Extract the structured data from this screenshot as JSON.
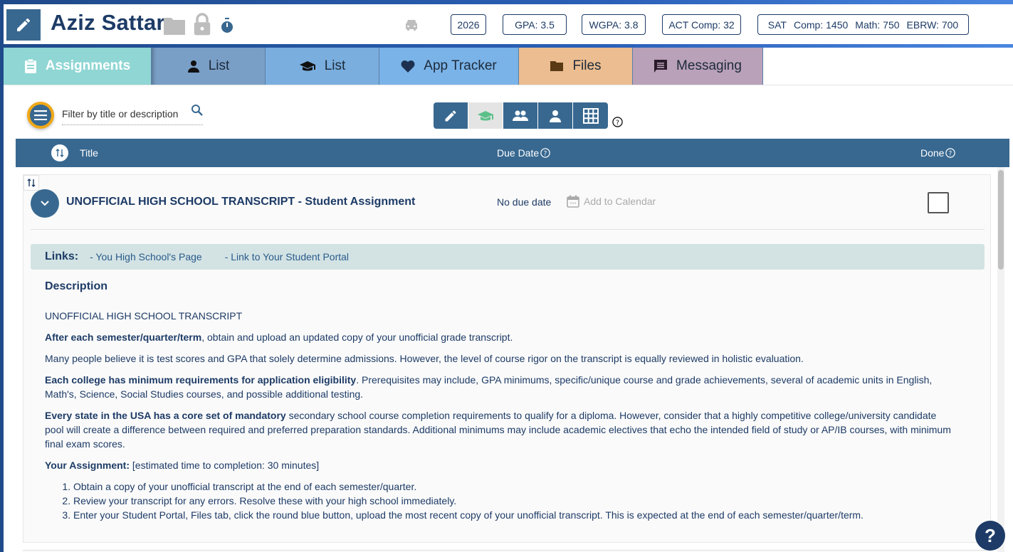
{
  "header": {
    "student_name": "Aziz Sattar",
    "icons": [
      "edit-icon",
      "folder-icon",
      "lock-icon",
      "stopwatch-icon",
      "car-icon"
    ],
    "badges": {
      "year": "2026",
      "gpa": "GPA: 3.5",
      "wgpa": "WGPA: 3.8",
      "act": "ACT Comp: 32",
      "sat_label": "SAT",
      "sat_comp": "Comp: 1450",
      "sat_math": "Math: 750",
      "sat_ebrw": "EBRW: 700"
    }
  },
  "tabs": [
    {
      "label": "Assignments",
      "icon": "clipboard-icon",
      "color": "#8fd6d4",
      "active": true
    },
    {
      "label": "List",
      "icon": "person-icon",
      "color": "#7a9fc7"
    },
    {
      "label": "List",
      "icon": "graduation-cap-icon",
      "color": "#7aaedf"
    },
    {
      "label": "App Tracker",
      "icon": "heart-icon",
      "color": "#7ab3e8"
    },
    {
      "label": "Files",
      "icon": "folder-icon",
      "color": "#ebbd90"
    },
    {
      "label": "Messaging",
      "icon": "message-icon",
      "color": "#b9a1b9"
    }
  ],
  "toolbar": {
    "filter_placeholder": "Filter by title or description",
    "view_buttons": [
      "pencil-icon",
      "graduation-cap-icon",
      "group-icon",
      "person-icon",
      "grid-icon"
    ],
    "active_view": "graduation-cap-icon"
  },
  "table": {
    "columns": {
      "title": "Title",
      "due_date": "Due Date",
      "done": "Done"
    },
    "rows": [
      {
        "title": "UNOFFICIAL HIGH SCHOOL TRANSCRIPT - Student Assignment",
        "due": "No due date",
        "add_calendar": "Add to Calendar",
        "done": false,
        "links_label": "Links:",
        "links": [
          "- You High School's Page",
          "- Link to Your Student Portal"
        ],
        "description_title": "Description",
        "description": {
          "heading": "UNOFFICIAL HIGH SCHOOL TRANSCRIPT",
          "p1_bold": "After each semester/quarter/term",
          "p1_rest": ", obtain and upload an updated copy of your unofficial grade transcript.",
          "p2": "Many people believe it is test scores and GPA that solely determine admissions. However, the level of course rigor on the transcript is equally reviewed in holistic evaluation.",
          "p3_bold": "Each college has minimum requirements for application eligibility",
          "p3_rest": ". Prerequisites may include, GPA minimums, specific/unique course and grade achievements, several of academic units in English, Math's, Science, Social Studies courses, and possible additional testing.",
          "p4_bold": "Every state in the USA has a core set of mandatory",
          "p4_rest": " secondary school course completion requirements to qualify for a diploma. However, consider that a highly competitive college/university candidate pool will create a difference between required and preferred preparation standards. Additional minimums may include academic electives that echo the intended field of study or AP/IB courses, with minimum final exam scores.",
          "p5_bold": "Your Assignment:",
          "p5_rest": " [estimated time to completion: 30 minutes]",
          "steps": [
            "Obtain a copy of your unofficial transcript at the end of each semester/quarter.",
            "Review your transcript for any errors. Resolve these with your high school immediately.",
            "Enter your Student Portal, Files tab, click the round blue button, upload the most recent copy of your unofficial transcript. This is expected at the end of each semester/quarter/term."
          ]
        }
      }
    ]
  },
  "help_fab": "?"
}
